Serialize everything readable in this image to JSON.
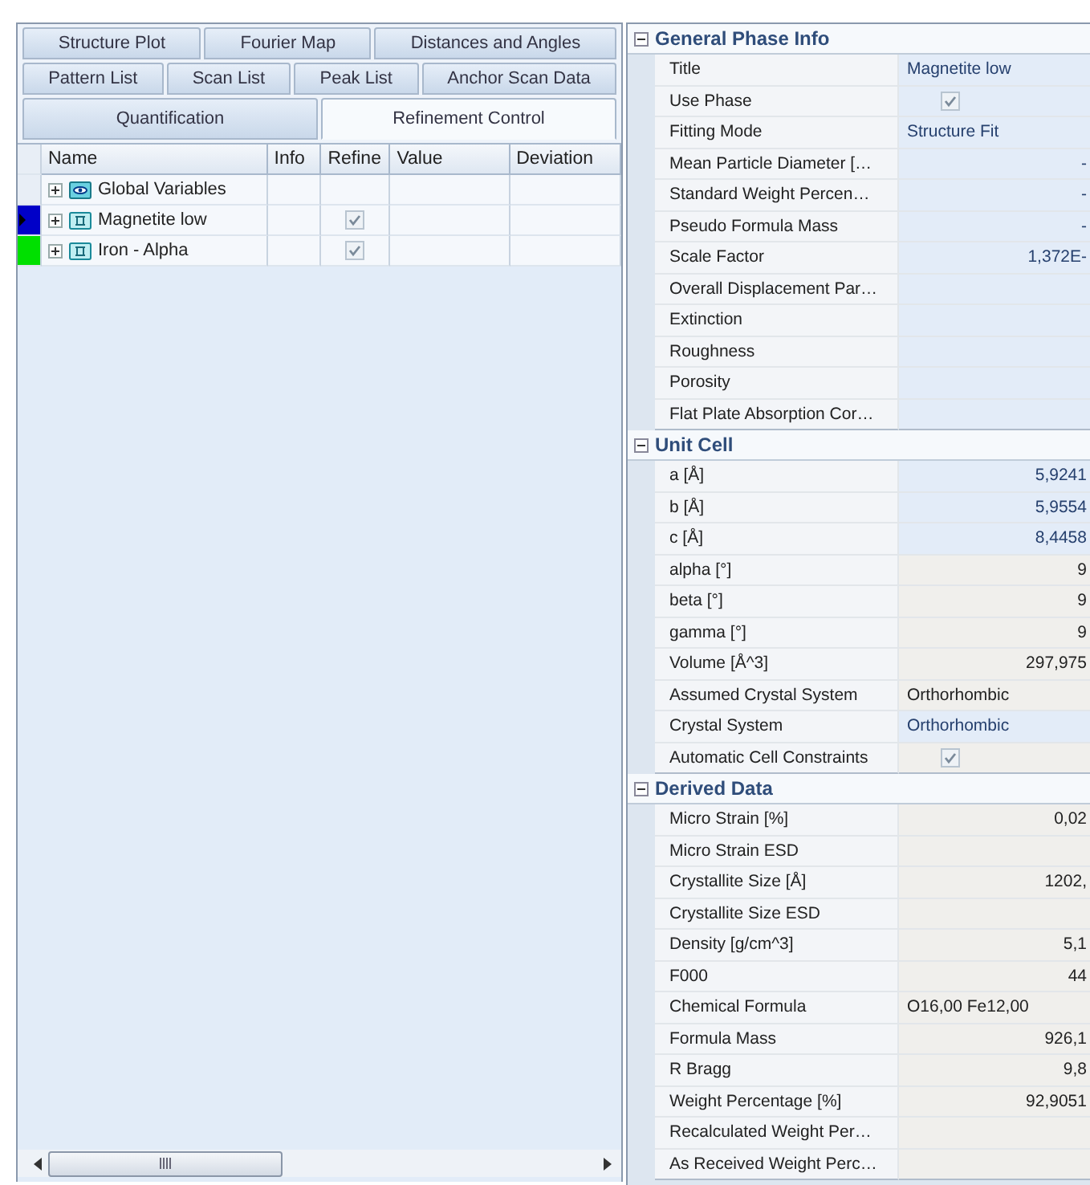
{
  "tabs": [
    [
      {
        "label": "Structure Plot",
        "selected": false
      },
      {
        "label": "Fourier Map",
        "selected": false
      },
      {
        "label": "Distances and Angles",
        "selected": false
      }
    ],
    [
      {
        "label": "Pattern List",
        "selected": false
      },
      {
        "label": "Scan List",
        "selected": false
      },
      {
        "label": "Peak List",
        "selected": false
      },
      {
        "label": "Anchor Scan Data",
        "selected": false
      }
    ],
    [
      {
        "label": "Quantification",
        "selected": false
      },
      {
        "label": "Refinement Control",
        "selected": true
      }
    ]
  ],
  "grid": {
    "columns": [
      "Name",
      "Info",
      "Refine",
      "Value",
      "Deviation"
    ],
    "rows": [
      {
        "name": "Global Variables",
        "kind": "variables",
        "selected": false
      },
      {
        "name": "Magnetite low",
        "kind": "phase",
        "color": "#0000c8",
        "selected": true,
        "refine": true
      },
      {
        "name": "Iron - Alpha",
        "kind": "phase",
        "color": "#00e000",
        "selected": false,
        "refine": true
      }
    ]
  },
  "sections": [
    {
      "title": "General Phase Info",
      "expanded": true,
      "rows": [
        {
          "label": "Title",
          "kind": "text",
          "value": "Magnetite low",
          "editable": true
        },
        {
          "label": "Use Phase",
          "kind": "check",
          "checked": true,
          "editable": true
        },
        {
          "label": "Fitting Mode",
          "kind": "text",
          "value": "Structure Fit",
          "editable": true
        },
        {
          "label": "Mean Particle Diameter […",
          "kind": "number",
          "value": "-",
          "editable": true
        },
        {
          "label": "Standard Weight Percen…",
          "kind": "number",
          "value": "-",
          "editable": true
        },
        {
          "label": "Pseudo Formula Mass",
          "kind": "number",
          "value": "-",
          "editable": true
        },
        {
          "label": "Scale Factor",
          "kind": "number",
          "value": "1,372E-",
          "editable": true
        },
        {
          "label": "Overall Displacement Par…",
          "kind": "number",
          "editable": true
        },
        {
          "label": "Extinction",
          "kind": "number",
          "editable": true
        },
        {
          "label": "Roughness",
          "kind": "number",
          "editable": true
        },
        {
          "label": "Porosity",
          "kind": "number",
          "editable": true
        },
        {
          "label": "Flat Plate Absorption Cor…",
          "kind": "number",
          "editable": true
        }
      ]
    },
    {
      "title": "Unit Cell",
      "expanded": true,
      "rows": [
        {
          "label": "a [Å]",
          "kind": "number",
          "value": "5,9241",
          "editable": true
        },
        {
          "label": "b [Å]",
          "kind": "number",
          "value": "5,9554",
          "editable": true
        },
        {
          "label": "c [Å]",
          "kind": "number",
          "value": "8,4458",
          "editable": true
        },
        {
          "label": "alpha [°]",
          "kind": "number",
          "value": "9",
          "editable": false
        },
        {
          "label": "beta [°]",
          "kind": "number",
          "value": "9",
          "editable": false
        },
        {
          "label": "gamma [°]",
          "kind": "number",
          "value": "9",
          "editable": false
        },
        {
          "label": "Volume [Å^3]",
          "kind": "number",
          "value": "297,975",
          "editable": false
        },
        {
          "label": "Assumed Crystal System",
          "kind": "text",
          "value": "Orthorhombic",
          "editable": false
        },
        {
          "label": "Crystal System",
          "kind": "text",
          "value": "Orthorhombic",
          "editable": true
        },
        {
          "label": "Automatic Cell Constraints",
          "kind": "check",
          "checked": true,
          "editable": false
        }
      ]
    },
    {
      "title": "Derived Data",
      "expanded": true,
      "rows": [
        {
          "label": "Micro Strain [%]",
          "kind": "number",
          "value": "0,02",
          "editable": false
        },
        {
          "label": "Micro Strain ESD",
          "kind": "number",
          "editable": false
        },
        {
          "label": "Crystallite Size [Å]",
          "kind": "number",
          "value": "1202,",
          "editable": false
        },
        {
          "label": "Crystallite Size ESD",
          "kind": "number",
          "editable": false
        },
        {
          "label": "Density [g/cm^3]",
          "kind": "number",
          "value": "5,1",
          "editable": false
        },
        {
          "label": "F000",
          "kind": "number",
          "value": "44",
          "editable": false
        },
        {
          "label": "Chemical Formula",
          "kind": "text",
          "value": "O16,00 Fe12,00",
          "editable": false
        },
        {
          "label": "Formula Mass",
          "kind": "number",
          "value": "926,1",
          "editable": false
        },
        {
          "label": "R Bragg",
          "kind": "number",
          "value": "9,8",
          "editable": false
        },
        {
          "label": "Weight Percentage [%]",
          "kind": "number",
          "value": "92,9051",
          "editable": false
        },
        {
          "label": "Recalculated Weight Per…",
          "kind": "number",
          "editable": false
        },
        {
          "label": "As Received Weight Perc…",
          "kind": "number",
          "editable": false
        }
      ]
    }
  ]
}
